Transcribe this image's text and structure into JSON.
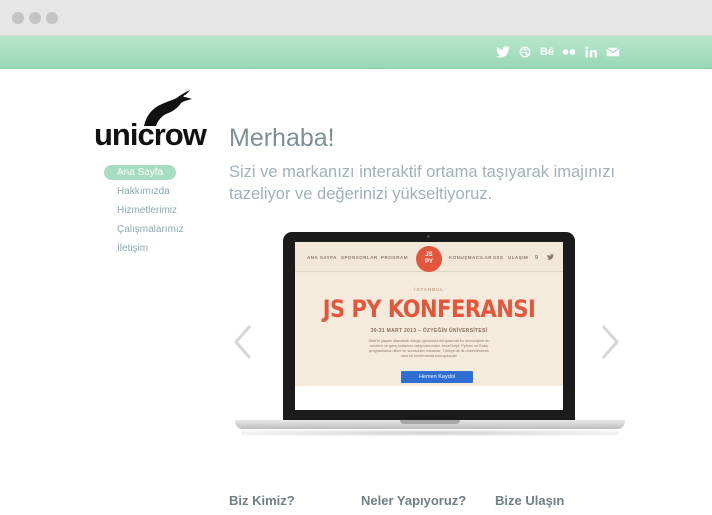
{
  "social": {
    "behance": "Bē",
    "icons": [
      "twitter-icon",
      "dribbble-icon",
      "behance-icon",
      "flickr-icon",
      "linkedin-icon",
      "mail-icon"
    ]
  },
  "brand": {
    "logo_text": "unicrow"
  },
  "nav": {
    "items": [
      {
        "label": "Ana Sayfa",
        "active": true
      },
      {
        "label": "Hakkımızda",
        "active": false
      },
      {
        "label": "Hizmetlerimiz",
        "active": false
      },
      {
        "label": "Çalışmalarımız",
        "active": false
      },
      {
        "label": "İletişim",
        "active": false
      }
    ]
  },
  "hero": {
    "headline": "Merhaba!",
    "tagline": "Sizi ve markanızı interaktif ortama taşıyarak imajınızı tazeliyor ve değerinizi yükseltiyoruz."
  },
  "screen": {
    "nav_left": [
      "ANA SAYFA",
      "SPONSORLAR",
      "PROGRAM"
    ],
    "nav_right": [
      "KONUŞMACILAR",
      "SSS",
      "ULAŞIM"
    ],
    "badge_line1": "JS",
    "badge_line2": "PY",
    "google_plus": "g",
    "city": "· İSTANBUL ·",
    "title": "JS PY KONFERANSI",
    "date": "30-31 MART 2013 – ÖZYEĞİN ÜNİVERSİTESİ",
    "paragraph": "Web'in yaşam standardı olduğu günümüz dünyasında bu teknolojinin en modern ve genç kullanımı taşıyıcılarından JavaScript, Python ve Ruby programlama dilleri ve sundukları imkanlar; Türkiye'de ilk düzenlenecek olan bu konferansta konuşulacak!",
    "button": "Hemen Kaydol"
  },
  "bottom": {
    "col1": "Biz Kimiz?",
    "col2": "Neler Yapıyoruz?",
    "col3": "Bize Ulaşın"
  },
  "colors": {
    "accent_green": "#a6dcbf",
    "conference_red": "#e5553b",
    "button_blue": "#2f6fd3"
  }
}
